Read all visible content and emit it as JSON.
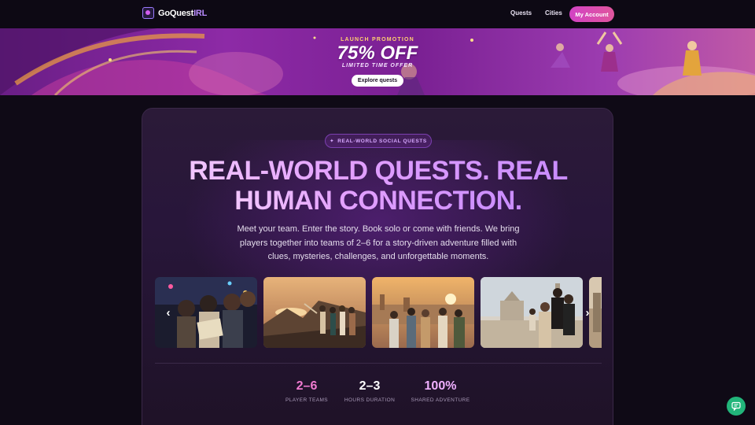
{
  "nav": {
    "logo_prefix": "GoQuest",
    "logo_suffix": "IRL",
    "links": [
      "Quests",
      "Cities"
    ],
    "account_label": "My Account"
  },
  "banner": {
    "label": "LAUNCH PROMOTION",
    "headline": "75% OFF",
    "sub": "LIMITED TIME OFFER",
    "cta": "Explore quests"
  },
  "hero": {
    "pill": "REAL-WORLD SOCIAL QUESTS",
    "pill_icon": "sparkle-icon",
    "headline_line1": "REAL-WORLD QUESTS. REAL",
    "headline_line2": "HUMAN CONNECTION.",
    "subtext": "Meet your team. Enter the story. Book solo or come with friends. We bring players together into teams of 2–6 for a story-driven adventure filled with clues, mysteries, challenges, and unforgettable moments."
  },
  "stats": [
    {
      "value": "2–6",
      "label": "PLAYER TEAMS"
    },
    {
      "value": "2–3",
      "label": "HOURS DURATION"
    },
    {
      "value": "100%",
      "label": "SHARED ADVENTURE"
    }
  ],
  "colors": {
    "accent": "#d243c4",
    "chat": "#22b57a",
    "background": "#0f0a16"
  }
}
